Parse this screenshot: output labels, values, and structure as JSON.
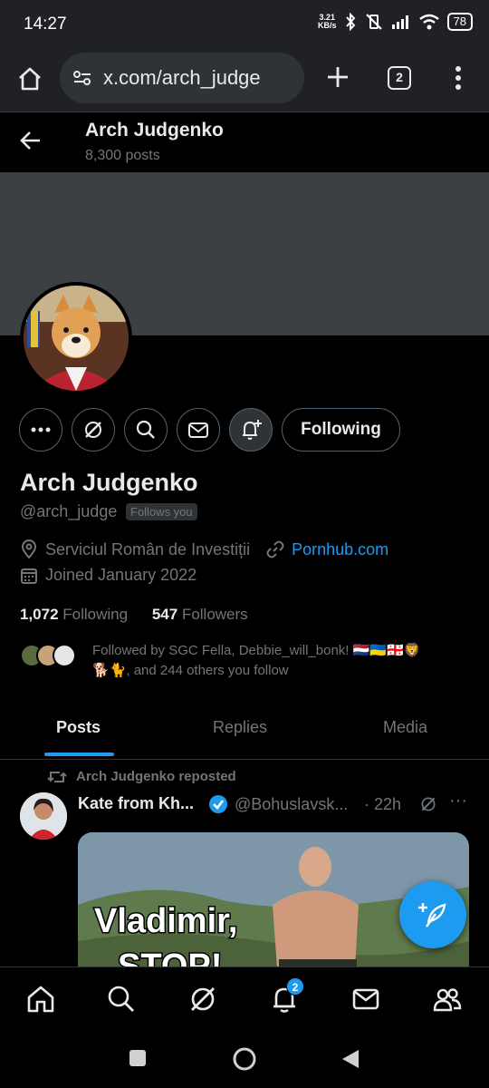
{
  "status_bar": {
    "time": "14:27",
    "net_speed_value": "3.21",
    "net_speed_unit": "KB/s",
    "battery": "78"
  },
  "browser": {
    "url": "x.com/arch_judge",
    "tab_count": "2"
  },
  "header": {
    "name": "Arch Judgenko",
    "posts_count": "8,300 posts"
  },
  "actions": {
    "following_label": "Following"
  },
  "profile": {
    "display_name": "Arch Judgenko",
    "handle": "@arch_judge",
    "follows_you": "Follows you",
    "location": "Serviciul Român de Investiții",
    "website": "Pornhub.com",
    "joined": "Joined January 2022",
    "following_count": "1,072",
    "following_label": "Following",
    "followers_count": "547",
    "followers_label": "Followers",
    "followed_by_line1": "Followed by SGC Fella, Debbie_will_bonk! 🇳🇱🇺🇦🇬🇪🦁",
    "followed_by_line2": "🐕🐈, and 244 others you follow"
  },
  "tabs": [
    {
      "label": "Posts",
      "active": true
    },
    {
      "label": "Replies",
      "active": false
    },
    {
      "label": "Media",
      "active": false
    }
  ],
  "post": {
    "repost_text": "Arch Judgenko reposted",
    "author_name": "Kate from Kh...",
    "author_handle": "@Bohuslavsk...",
    "time": "· 22h",
    "more": "···",
    "media_caption_line1": "Vladimir,",
    "media_caption_line2": "STOP!"
  },
  "bottom_nav": {
    "notification_badge": "2"
  },
  "colors": {
    "accent": "#1d9bf0",
    "background": "#000000",
    "banner": "#3c4043",
    "muted_text": "#71767b"
  }
}
